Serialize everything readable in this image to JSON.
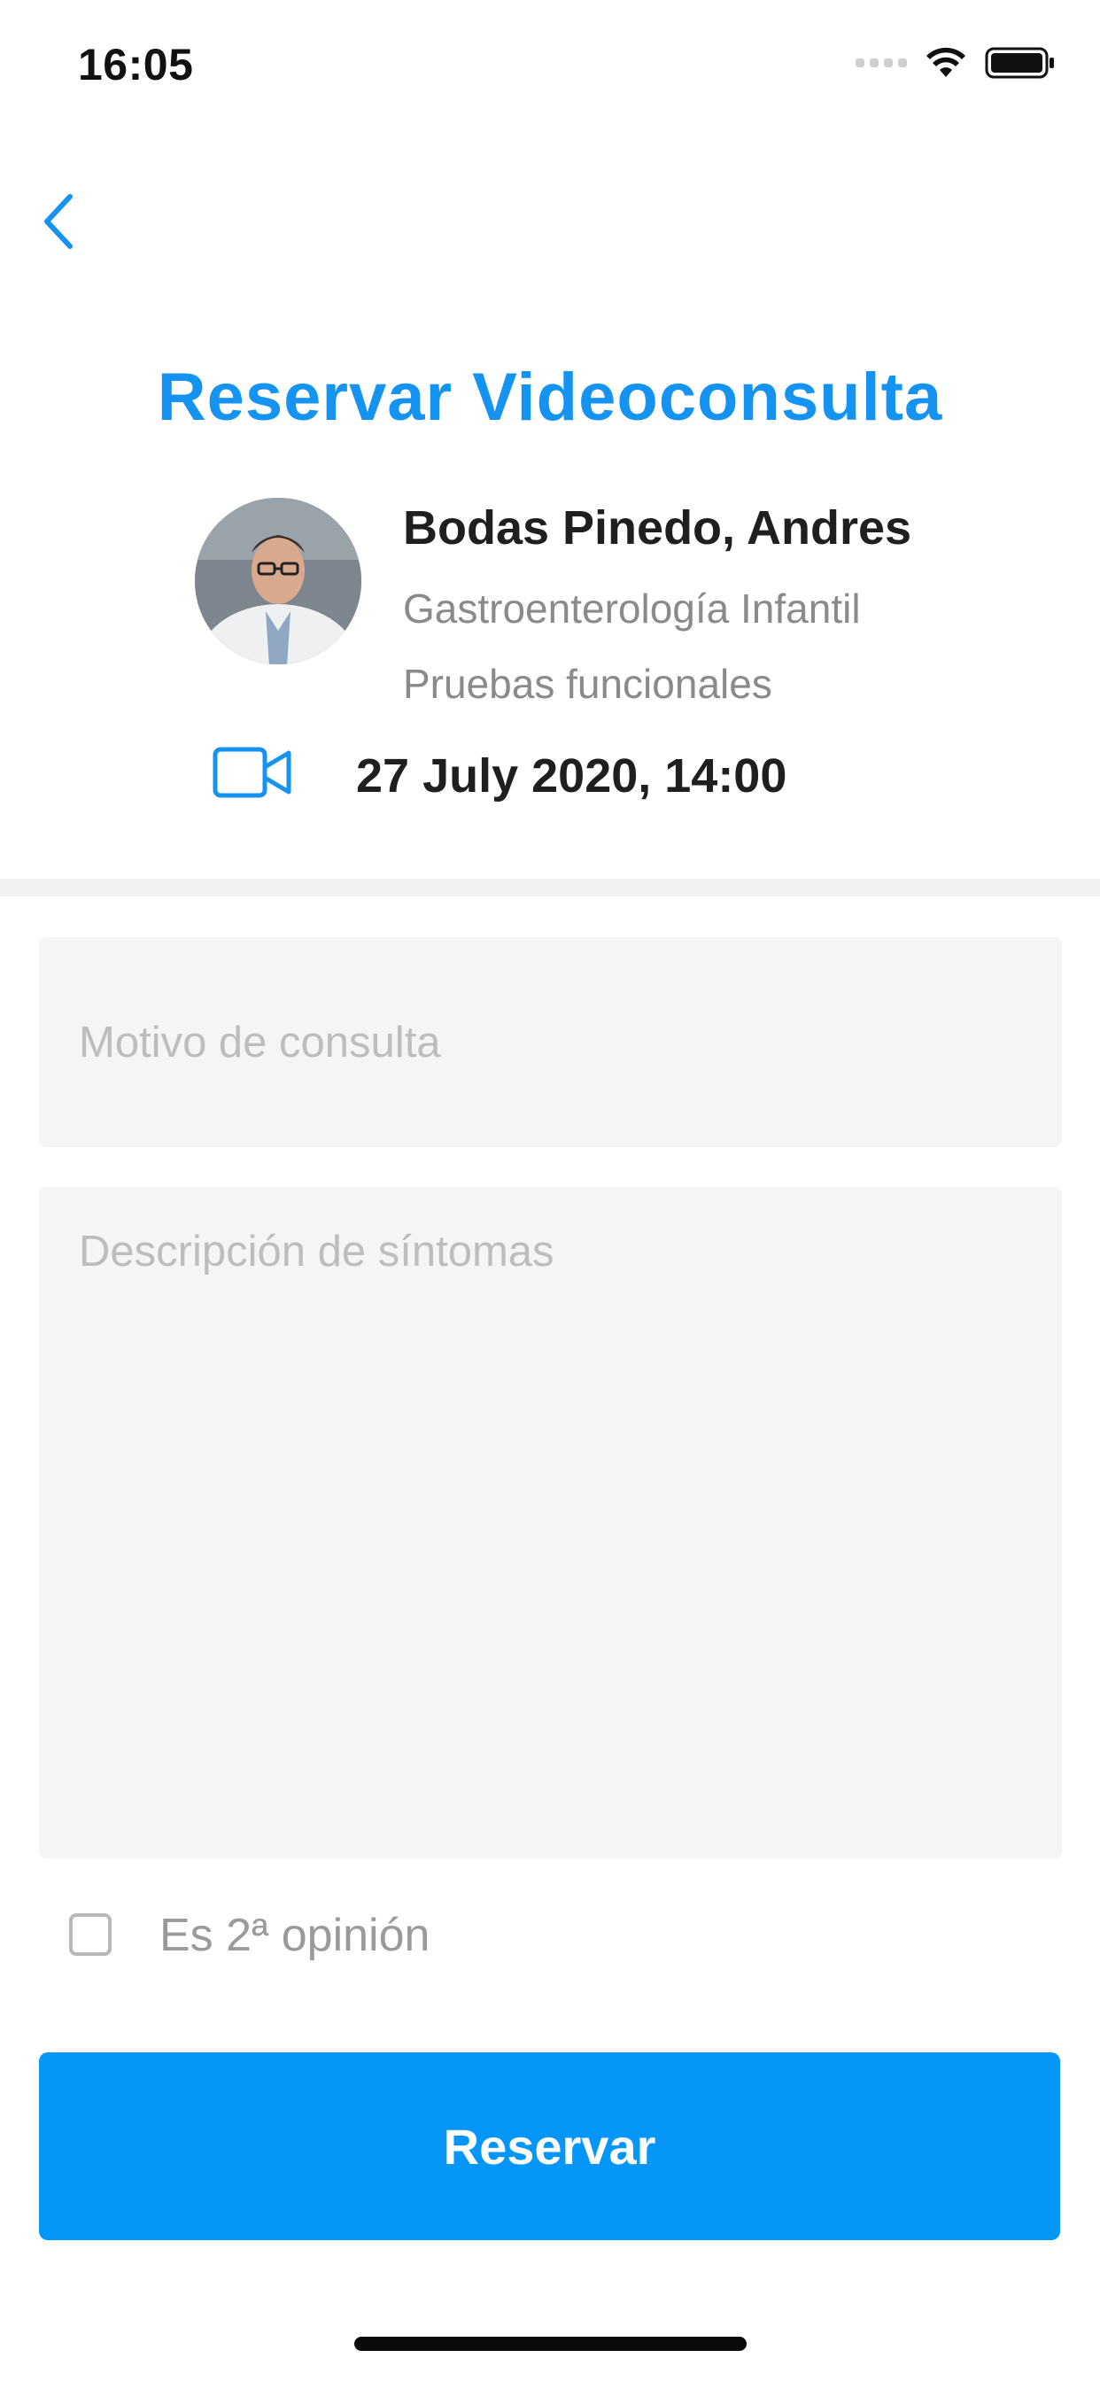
{
  "status_bar": {
    "time": "16:05",
    "icons": [
      "cellular-signal-icon",
      "wifi-icon",
      "battery-icon"
    ]
  },
  "nav": {
    "back_icon": "chevron-left-icon"
  },
  "header": {
    "title": "Reservar Videoconsulta"
  },
  "doctor": {
    "name": "Bodas Pinedo, Andres",
    "specialty": "Gastroenterología Infantil",
    "service": "Pruebas funcionales",
    "avatar": "doctor-photo"
  },
  "appointment": {
    "icon": "video-camera-icon",
    "datetime": "27 July 2020, 14:00"
  },
  "form": {
    "reason": {
      "placeholder": "Motivo de consulta",
      "value": ""
    },
    "symptoms": {
      "placeholder": "Descripción de síntomas",
      "value": ""
    },
    "second_opinion": {
      "label": "Es 2ª opinión",
      "checked": false
    },
    "submit_label": "Reservar"
  },
  "colors": {
    "accent": "#0696f8",
    "title": "#1593f0",
    "input_bg": "#f5f5f5",
    "placeholder": "#bdbdbd"
  }
}
